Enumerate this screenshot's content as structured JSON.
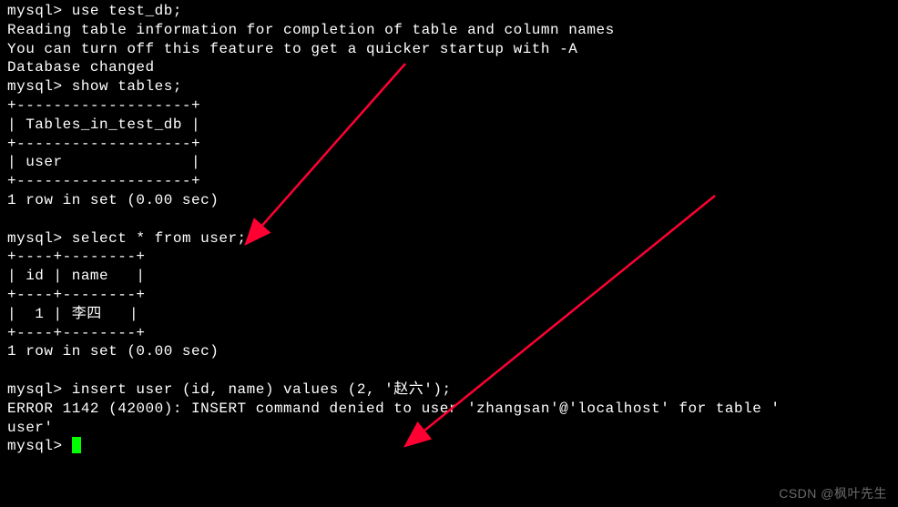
{
  "prompt": "mysql> ",
  "commands": {
    "use_db": "use test_db;",
    "show_tables": "show tables;",
    "select_user": "select * from user;",
    "insert_user": "insert user (id, name) values (2, '赵六');"
  },
  "output": {
    "reading_info": "Reading table information for completion of table and column names",
    "turn_off": "You can turn off this feature to get a quicker startup with -A",
    "blank": "",
    "db_changed": "Database changed",
    "tables_sep": "+-------------------+",
    "tables_header": "| Tables_in_test_db |",
    "tables_row": "| user              |",
    "row_count": "1 row in set (0.00 sec)",
    "user_sep": "+----+--------+",
    "user_header": "| id | name   |",
    "user_row": "|  1 | 李四   |",
    "error": "ERROR 1142 (42000): INSERT command denied to user 'zhangsan'@'localhost' for table '",
    "error_cont": "user'"
  },
  "watermark": "CSDN @枫叶先生"
}
